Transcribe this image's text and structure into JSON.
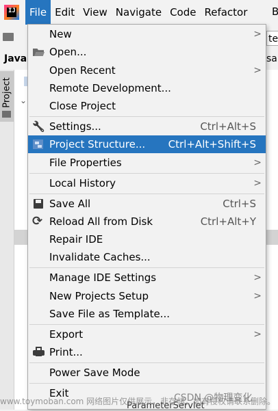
{
  "menubar": {
    "items": [
      "File",
      "Edit",
      "View",
      "Navigate",
      "Code",
      "Refactor",
      "B"
    ],
    "active": "File",
    "accent": "#2675bf"
  },
  "background": {
    "tab_label": "Java",
    "side_panel_label": "Project",
    "right_text_1": "te",
    "right_text_2": "sak",
    "bottom_item": "ParameterServlet"
  },
  "file_menu": {
    "items": [
      {
        "label": "New",
        "submenu": true
      },
      {
        "label": "Open...",
        "icon": "folder-open-icon"
      },
      {
        "label": "Open Recent",
        "submenu": true
      },
      {
        "label": "Remote Development..."
      },
      {
        "label": "Close Project"
      },
      {
        "label": "Settings...",
        "icon": "wrench-icon",
        "shortcut": "Ctrl+Alt+S"
      },
      {
        "label": "Project Structure...",
        "icon": "project-structure-icon",
        "shortcut": "Ctrl+Alt+Shift+S",
        "highlighted": true
      },
      {
        "label": "File Properties",
        "submenu": true
      },
      {
        "label": "Local History",
        "submenu": true
      },
      {
        "label": "Save All",
        "icon": "save-icon",
        "shortcut": "Ctrl+S"
      },
      {
        "label": "Reload All from Disk",
        "icon": "reload-icon",
        "shortcut": "Ctrl+Alt+Y"
      },
      {
        "label": "Repair IDE"
      },
      {
        "label": "Invalidate Caches..."
      },
      {
        "label": "Manage IDE Settings",
        "submenu": true
      },
      {
        "label": "New Projects Setup",
        "submenu": true
      },
      {
        "label": "Save File as Template..."
      },
      {
        "label": "Export",
        "submenu": true
      },
      {
        "label": "Print...",
        "icon": "print-icon"
      },
      {
        "label": "Power Save Mode"
      },
      {
        "label": "Exit"
      }
    ]
  },
  "watermark": {
    "left": "www.toymoban.com 网络图片仅供展示，非存储，如有侵权请联系删除。",
    "csdn": "CSDN @物理变化"
  }
}
